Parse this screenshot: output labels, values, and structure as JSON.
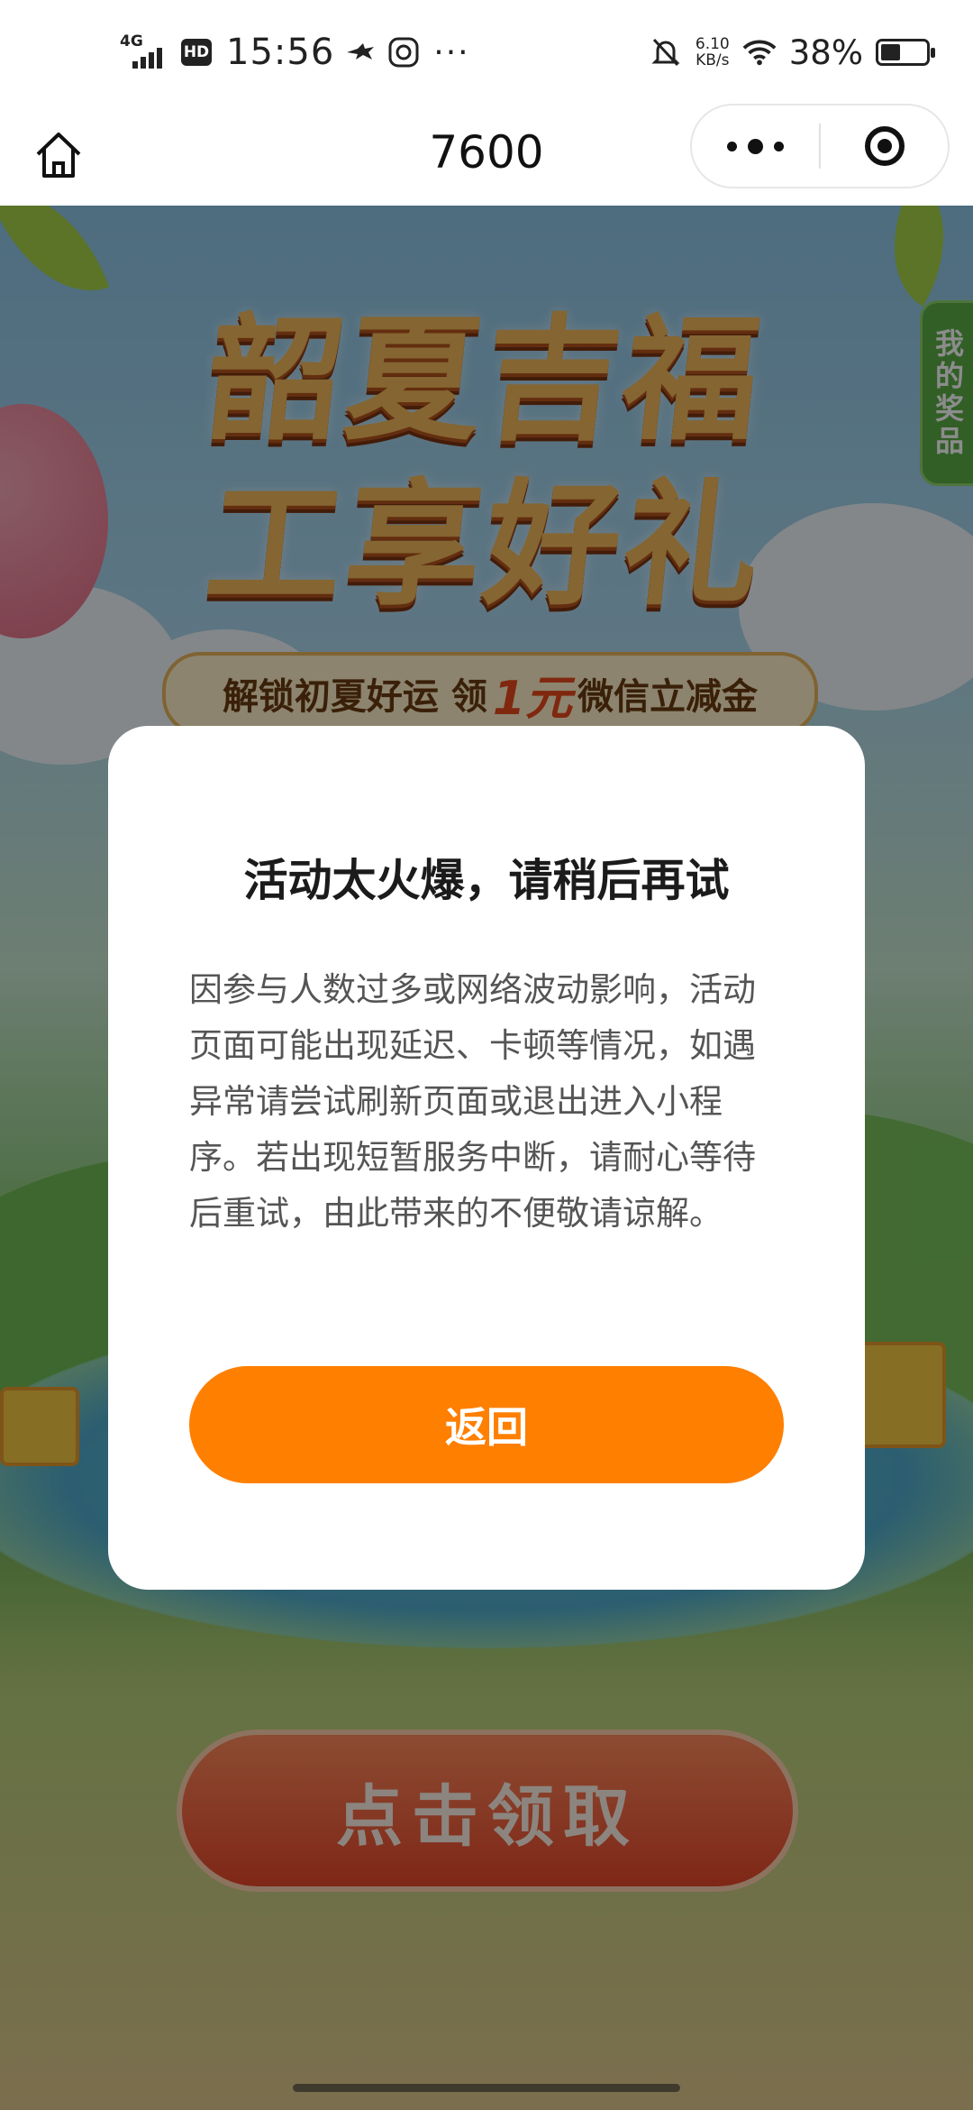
{
  "status_bar": {
    "network": "4G",
    "hd": "HD",
    "time": "15:56",
    "more": "···",
    "speed_value": "6.10",
    "speed_unit": "KB/s",
    "battery_percent": "38%",
    "battery_level": 0.38
  },
  "title_bar": {
    "title": "7600"
  },
  "background": {
    "headline_line1": "韶夏吉福",
    "headline_line2": "工享好礼",
    "sub_banner_before": "解锁初夏好运 领",
    "sub_banner_highlight": "1元",
    "sub_banner_after": "微信立减金",
    "my_prizes": "我的奖品",
    "claim_button": "点击领取"
  },
  "modal": {
    "title": "活动太火爆，请稍后再试",
    "body": "因参与人数过多或网络波动影响，活动页面可能出现延迟、卡顿等情况，如遇异常请尝试刷新页面或退出进入小程序。若出现短暂服务中断，请耐心等待后重试，由此带来的不便敬请谅解。",
    "button_label": "返回",
    "button_color": "#ff7f00"
  }
}
